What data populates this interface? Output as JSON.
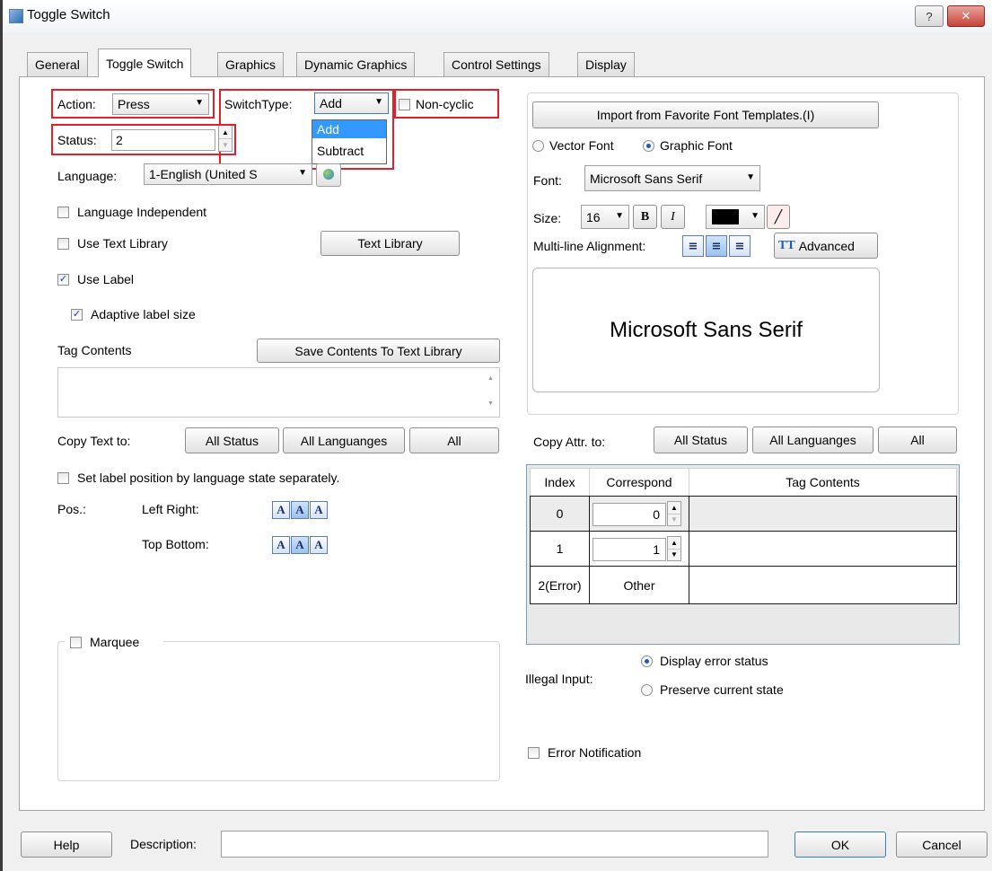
{
  "window": {
    "title": "Toggle Switch",
    "help_glyph": "?",
    "close_glyph": "✕"
  },
  "tabs": [
    "General",
    "Toggle Switch",
    "Graphics",
    "Dynamic Graphics",
    "Control Settings",
    "Display"
  ],
  "left": {
    "action_label": "Action:",
    "action_value": "Press",
    "switchtype_label": "SwitchType:",
    "switchtype_value": "Add",
    "switchtype_options": [
      "Add",
      "Subtract"
    ],
    "noncyclic_label": "Non-cyclic",
    "status_label": "Status:",
    "status_value": "2",
    "language_label": "Language:",
    "language_value": "1-English (United S",
    "language_independent": "Language Independent",
    "use_text_library": "Use Text Library",
    "text_library_button": "Text Library",
    "use_label": "Use Label",
    "adaptive_label": "Adaptive label size",
    "tag_contents_label": "Tag Contents",
    "save_contents_button": "Save Contents To Text Library",
    "copy_text_label": "Copy Text to:",
    "copy_buttons": [
      "All Status",
      "All Languanges",
      "All"
    ],
    "set_label_position": "Set label position by language  state separately.",
    "pos_label": "Pos.:",
    "left_right_label": "Left Right:",
    "top_bottom_label": "Top Bottom:",
    "marquee_label": "Marquee"
  },
  "right": {
    "import_button": "Import from Favorite Font Templates.(I)",
    "vector_font": "Vector Font",
    "graphic_font": "Graphic Font",
    "font_label": "Font:",
    "font_value": "Microsoft Sans Serif",
    "size_label": "Size:",
    "size_value": "16",
    "bold": "B",
    "italic": "I",
    "multiline_label": "Multi-line Alignment:",
    "advanced_button": "Advanced",
    "advanced_icon_text": "TT",
    "preview_text": "Microsoft Sans Serif",
    "copy_attr_label": "Copy Attr. to:",
    "copy_buttons": [
      "All Status",
      "All Languanges",
      "All"
    ],
    "table_headers": [
      "Index",
      "Correspond",
      "Tag Contents"
    ],
    "rows": [
      {
        "index": "0",
        "correspond": "0"
      },
      {
        "index": "1",
        "correspond": "1"
      },
      {
        "index": "2(Error)",
        "correspond": "Other"
      }
    ],
    "illegal_input_label": "Illegal Input:",
    "display_error": "Display error status",
    "preserve_state": "Preserve current state",
    "error_notification": "Error Notification"
  },
  "footer": {
    "help_button": "Help",
    "description_label": "Description:",
    "description_value": "",
    "ok_button": "OK",
    "cancel_button": "Cancel"
  },
  "colors": {
    "highlight_red": "#e0202a",
    "selection_blue": "#3399ff",
    "font_color": "#000000"
  }
}
